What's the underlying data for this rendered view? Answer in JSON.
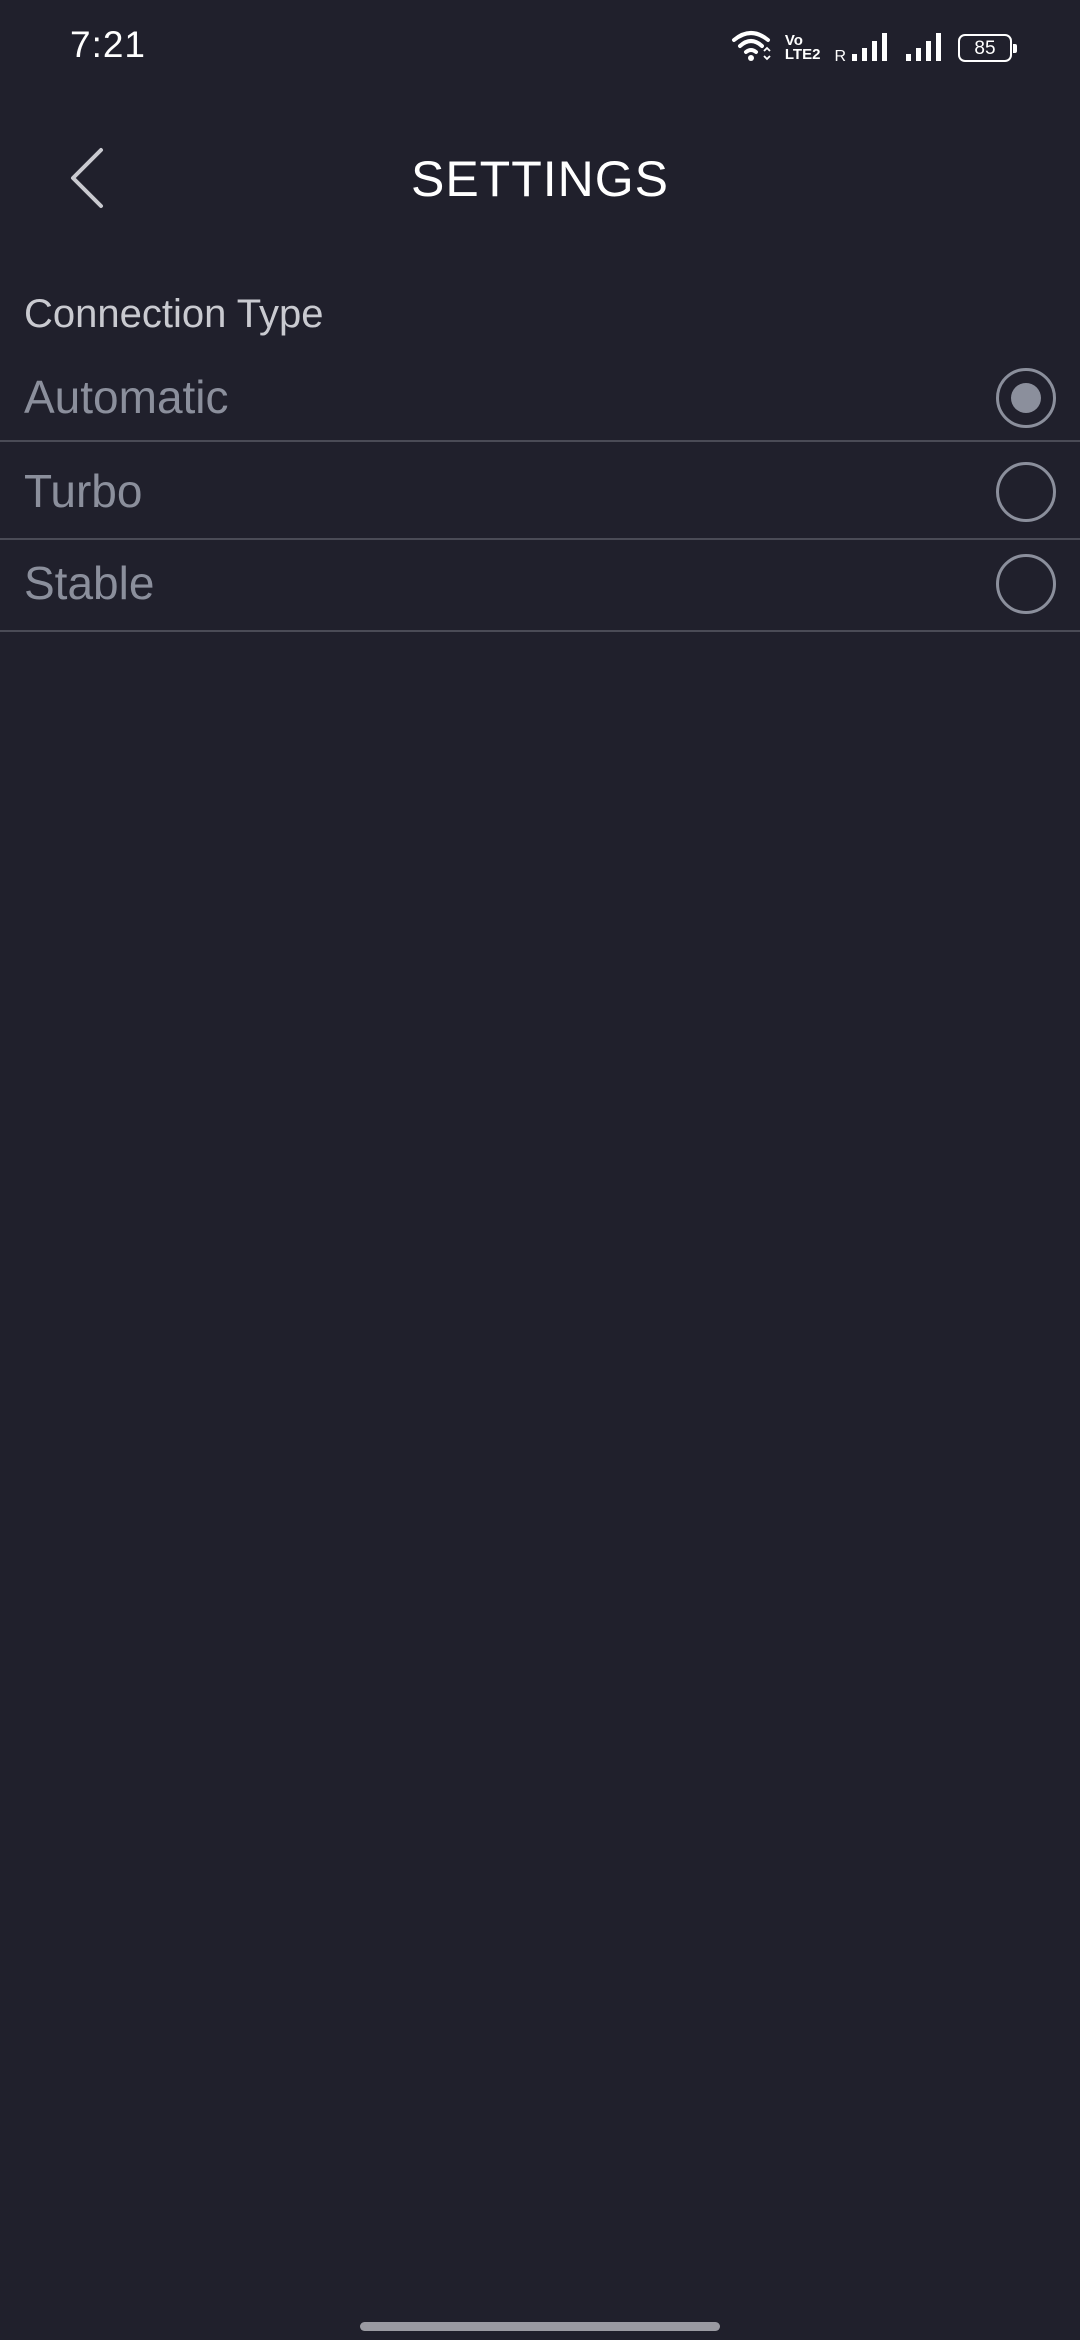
{
  "status_bar": {
    "time": "7:21",
    "volte_line1": "Vo",
    "volte_line2": "LTE2",
    "roaming": "R",
    "battery": "85",
    "icons": [
      "wifi-icon",
      "volte-icon",
      "signal-icon",
      "signal-icon",
      "battery-icon"
    ]
  },
  "header": {
    "back_icon": "chevron-left-icon",
    "title": "SETTINGS"
  },
  "connection": {
    "section_label": "Connection Type",
    "options": [
      {
        "label": "Automatic",
        "selected": true
      },
      {
        "label": "Turbo",
        "selected": false
      },
      {
        "label": "Stable",
        "selected": false
      }
    ]
  },
  "colors": {
    "background": "#20202c",
    "title": "#ffffff",
    "section_label": "#c9cad0",
    "option_text": "#8b8f9c",
    "divider": "#4a4b56"
  }
}
